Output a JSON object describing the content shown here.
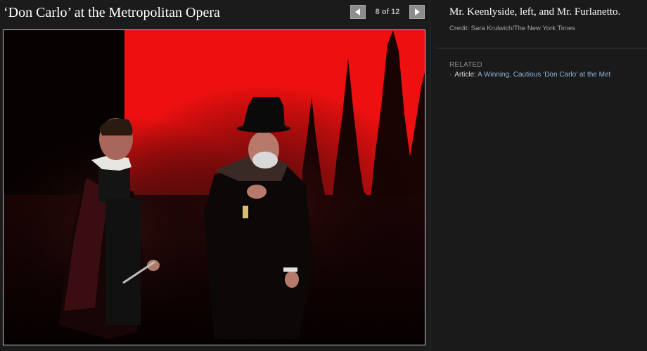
{
  "slideshow": {
    "title": "‘Don Carlo’ at the Metropolitan Opera",
    "counter": "8 of 12",
    "prev_icon": "left-arrow-icon",
    "next_icon": "right-arrow-icon"
  },
  "photo": {
    "subject": "opera-stage-photo"
  },
  "caption": {
    "text": "Mr. Keenlyside, left, and Mr. Furlanetto.",
    "credit": "Credit: Sara Krulwich/The New York Times"
  },
  "related": {
    "heading": "RELATED",
    "items": [
      {
        "prefix": "Article:",
        "link_text": "A Winning, Cautious ‘Don Carlo’ at the Met"
      }
    ]
  },
  "colors": {
    "background": "#1a1a1a",
    "link": "#8fb4d9",
    "stage_red": "#ee1010"
  }
}
